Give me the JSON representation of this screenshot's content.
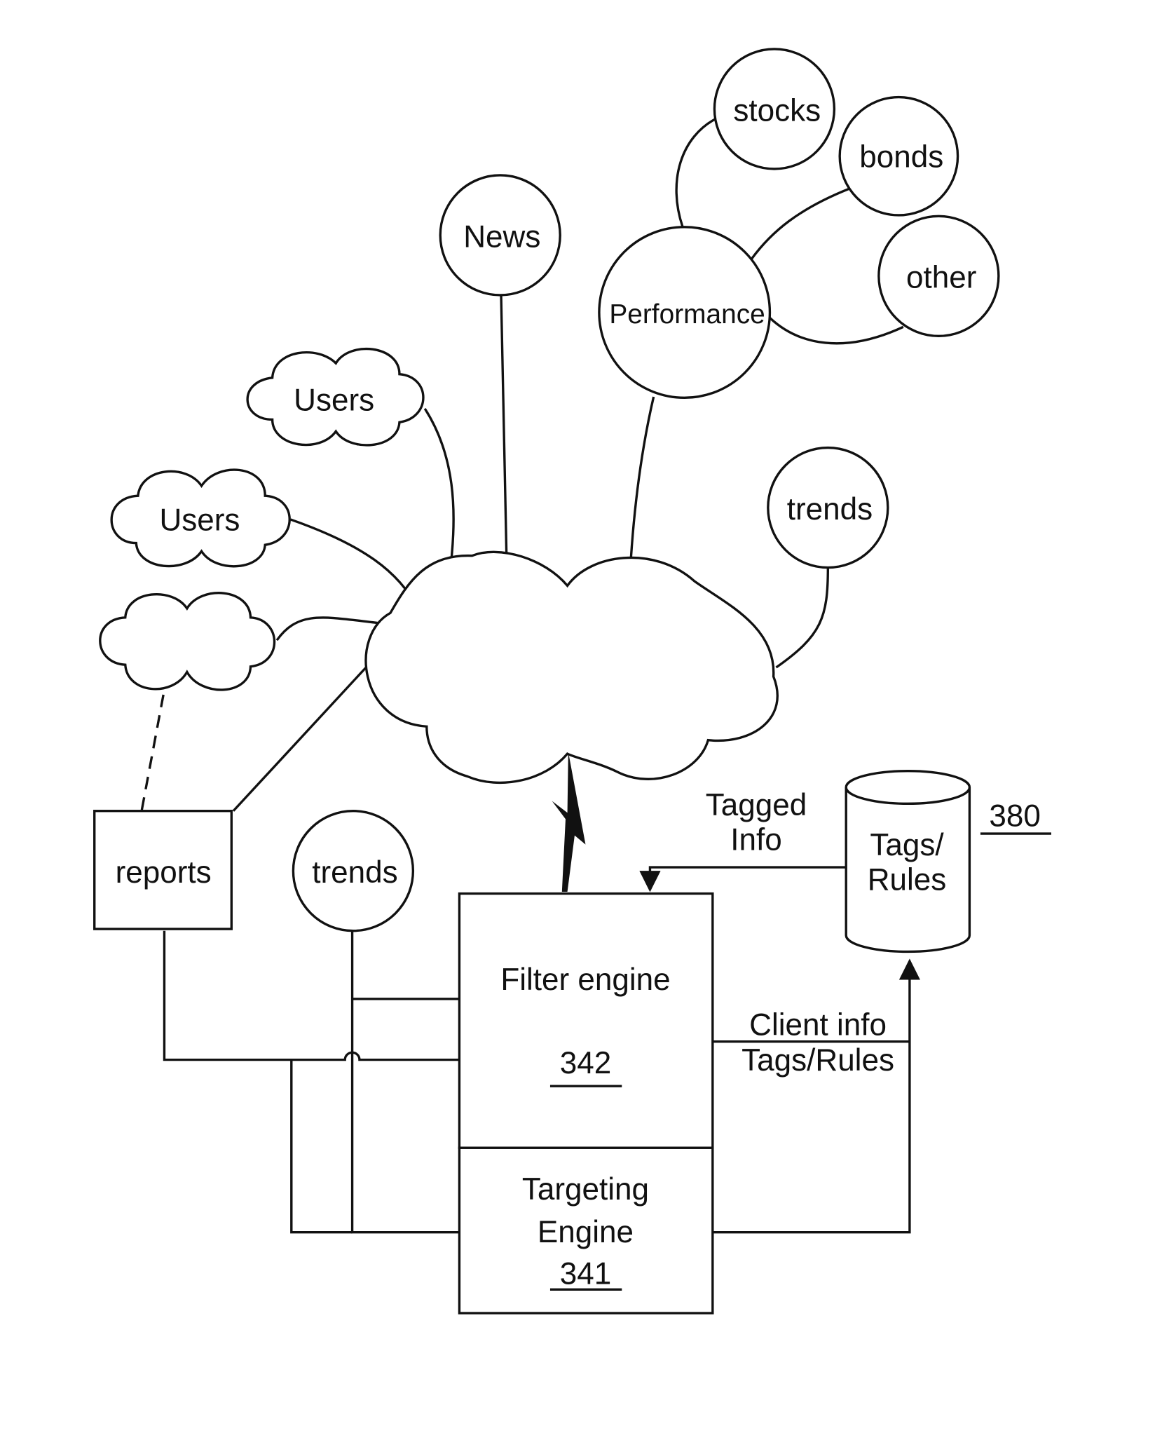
{
  "nodes": {
    "stocks": "stocks",
    "bonds": "bonds",
    "other": "other",
    "news": "News",
    "performance": "Performance",
    "users_top": "Users",
    "users_mid": "Users",
    "trends_right": "trends",
    "trends_bottom": "trends",
    "reports": "reports"
  },
  "filter_engine": {
    "label": "Filter engine",
    "ref": "342"
  },
  "targeting_engine": {
    "line1": "Targeting",
    "line2": "Engine",
    "ref": "341"
  },
  "database": {
    "line1": "Tags/",
    "line2": "Rules",
    "ref": "380"
  },
  "arrows": {
    "tagged_info_1": "Tagged",
    "tagged_info_2": "Info",
    "client_info": "Client info",
    "tags_rules": "Tags/Rules"
  }
}
